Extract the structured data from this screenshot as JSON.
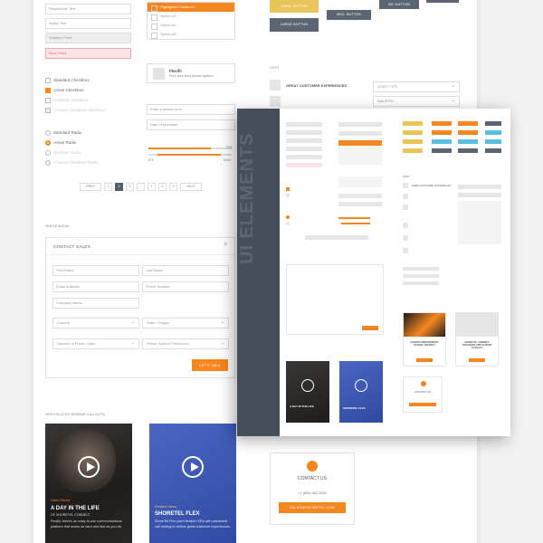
{
  "forms": {
    "placeholder_text": "Placeholder Text",
    "active_text": "Active Text",
    "disabled_field": "Disabled Field",
    "error_field": "Error Field"
  },
  "dropdown": {
    "options": [
      "Highlighted Option #1",
      "Option #3",
      "Option #4",
      "Option #5"
    ]
  },
  "buttons": {
    "large_button": "LARGE BUTTON",
    "med_button": "MED. BUTTON",
    "sm_button": "SM. BUTTON",
    "large_button_2": "LARGE BUTTON"
  },
  "checkboxes": {
    "standard_checkbox": "Standard Checkbox",
    "active_checkbox": "Active Checkbox",
    "disabled_checkbox": "Disabled Checkbox",
    "checked_disabled_checkbox": "Checked Disabled Checkbox"
  },
  "radios": {
    "standard_radio": "Standard Radio",
    "active_radio": "Active Radio",
    "disabled_radio": "Disabled Radio",
    "checked_disabled_radio": "Checked Disabled Radio"
  },
  "product_search": {
    "title": "Plexifit",
    "subtitle": "Find your best phone system"
  },
  "search_field": "Enter a search term",
  "date_field": "Date of purchase",
  "sliders": {
    "low_label": "$75",
    "high_label": "$400",
    "end_label": "75%"
  },
  "pagination": {
    "prev": "PREV",
    "pages": [
      "1",
      "2",
      "3",
      "...",
      "7",
      "8",
      "9"
    ],
    "next": "NEXT"
  },
  "lists_heading": "LISTS",
  "list_item": "GREAT CUSTOMER EXPERIENCES",
  "filters": [
    "ASSET TYPE",
    "INDUSTRY"
  ],
  "modal_heading": "SIMPLE MODAL",
  "modal": {
    "title": "CONTACT SALES",
    "first_name": "First Name",
    "last_name": "Last Name",
    "email": "Email Address",
    "phone": "Phone Number",
    "company": "Company Name",
    "country": "Country",
    "state": "State / Region",
    "num_phones": "Number of Phone Lines",
    "phone_pref": "Phone System Preference",
    "submit": "LET'S TALK"
  },
  "video_heading": "VIDEO BLOCKS (SIDEBAR CALLOUTS)",
  "video_cards": [
    {
      "kicker": "Video Series",
      "title": "A DAY IN THE LIFE",
      "subtitle": "OF SHORETEL CONNECT",
      "body": "Finally, there's an easy-to-use communications platform that works as hard and fast as you do."
    },
    {
      "kicker": "Product Demo",
      "title": "SHORETEL FLEX",
      "subtitle": "",
      "body": "ShoreTel Flex pairs flexible IVRs with advanced call routing to deliver great customer experiences."
    }
  ],
  "contact": {
    "title": "CONTACT US",
    "phone": "+1 (800) 962-2835",
    "email": "SALES@SHORETEL.COM"
  },
  "front": {
    "title": "UI ELEMENTS",
    "lists_heading": "LISTS",
    "list_item": "GREAT CUSTOMER EXPERIENCES",
    "video1_title": "A DAY IN THE LIFE",
    "video2_title": "SHORETEL FLEX",
    "case1": "HAWAII'S INDEPENDENT SCHOOL DISTRICT",
    "case2": "SHORETEL CONNECT ADVANCED APPLICATION CATALOG",
    "contact_title": "CONTACT US"
  },
  "colors": {
    "accent": "#f6861f",
    "slate": "#5b6672",
    "sidebar": "#46505b",
    "cyan": "#5bc0de",
    "yellow": "#e9c45b",
    "error_bg": "#fde3e6",
    "video_blue": "#3c59b4"
  }
}
